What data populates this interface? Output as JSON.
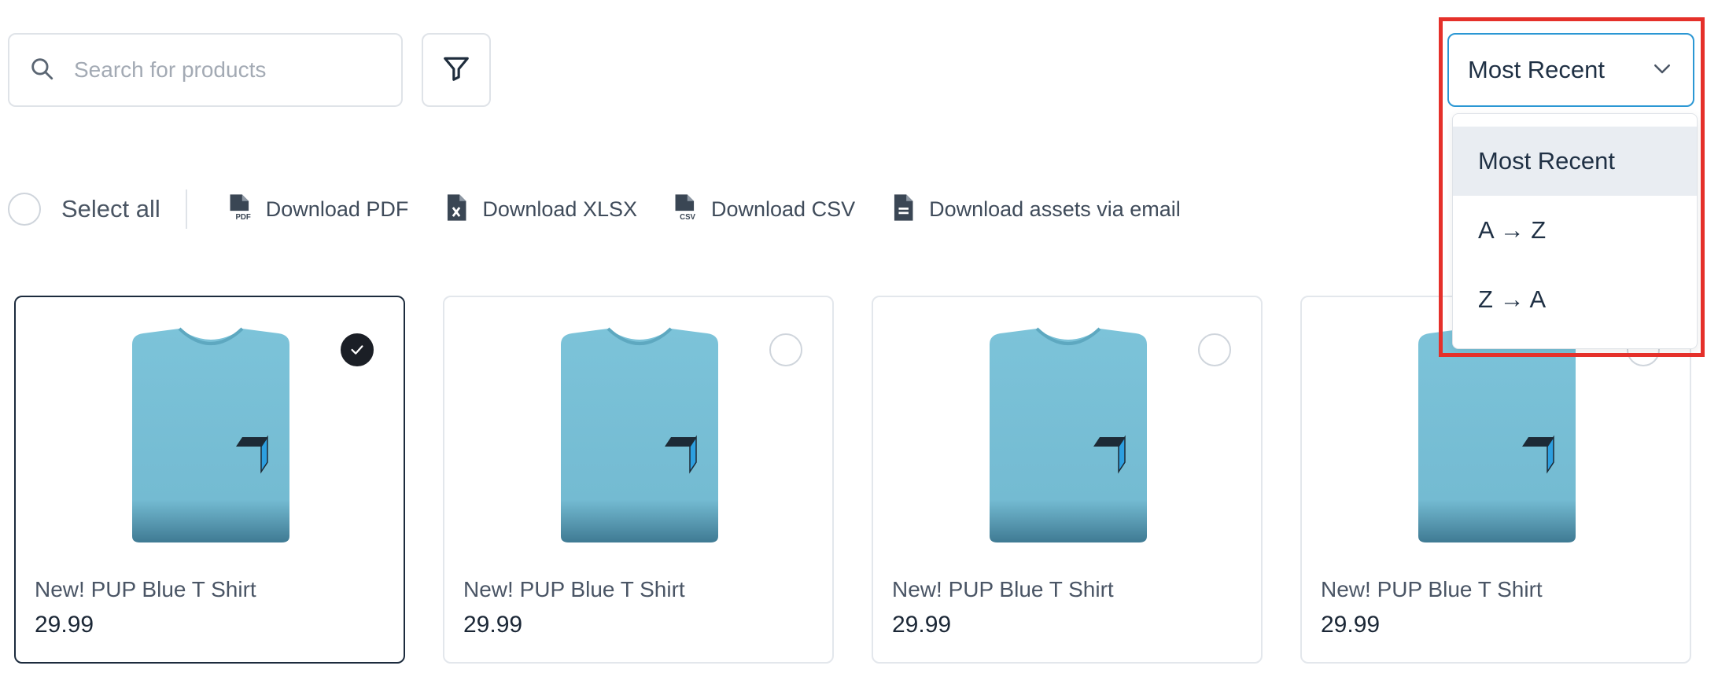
{
  "search": {
    "placeholder": "Search for products",
    "value": ""
  },
  "sort": {
    "selected": "Most Recent",
    "options": [
      "Most Recent",
      "A → Z",
      "Z → A"
    ]
  },
  "toolbar": {
    "select_all": "Select all",
    "download_pdf": "Download PDF",
    "download_xlsx": "Download XLSX",
    "download_csv": "Download CSV",
    "download_email": "Download assets via email"
  },
  "products": [
    {
      "name": "New! PUP Blue T Shirt",
      "price": "29.99",
      "selected": true
    },
    {
      "name": "New! PUP Blue T Shirt",
      "price": "29.99",
      "selected": false
    },
    {
      "name": "New! PUP Blue T Shirt",
      "price": "29.99",
      "selected": false
    },
    {
      "name": "New! PUP Blue T Shirt",
      "price": "29.99",
      "selected": false
    }
  ],
  "colors": {
    "accent": "#2b97d4",
    "highlight": "#e5302a",
    "shirt": "#76bed5"
  }
}
